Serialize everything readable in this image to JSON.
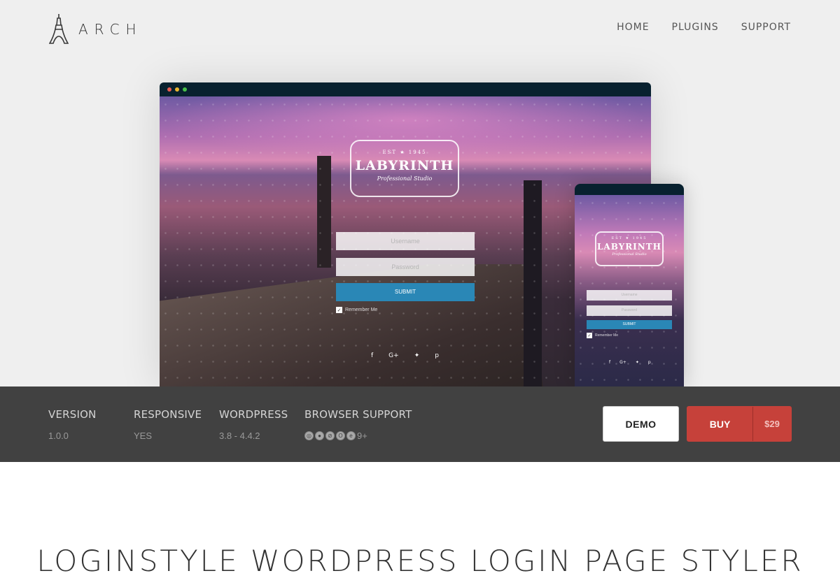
{
  "header": {
    "logo_text": "ARCH",
    "nav": [
      {
        "label": "HOME"
      },
      {
        "label": "PLUGINS"
      },
      {
        "label": "SUPPORT"
      }
    ]
  },
  "preview": {
    "badge": {
      "est": "EST ★ 1945",
      "brand": "LABYRINTH",
      "sub": "Professional Studio"
    },
    "username_placeholder": "Username",
    "password_placeholder": "Password",
    "submit_label": "SUBMIT",
    "remember_label": "Remember Me",
    "social_icons": [
      "f",
      "G+",
      "twitter",
      "p"
    ],
    "window_dots": [
      "#e85a50",
      "#e9b52f",
      "#48c04a"
    ]
  },
  "info": [
    {
      "label": "VERSION",
      "value": "1.0.0"
    },
    {
      "label": "RESPONSIVE",
      "value": "YES"
    },
    {
      "label": "WORDPRESS",
      "value": "3.8 - 4.4.2"
    },
    {
      "label": "BROWSER SUPPORT",
      "value": "9+"
    }
  ],
  "browser_icons": [
    "chrome-icon",
    "firefox-icon",
    "safari-icon",
    "opera-icon",
    "ie-icon"
  ],
  "actions": {
    "demo_label": "DEMO",
    "buy_label": "BUY",
    "price": "$29",
    "buy_color": "#c6413a"
  },
  "headline": "LOGINSTYLE WORDPRESS LOGIN PAGE STYLER"
}
